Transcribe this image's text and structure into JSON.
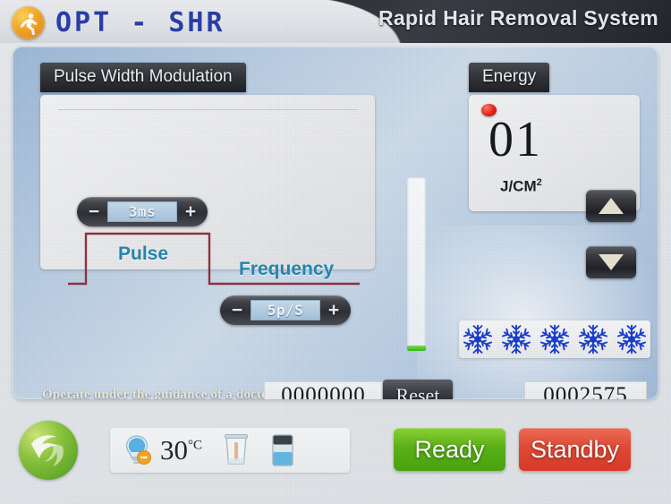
{
  "header": {
    "brand_title": "OPT - SHR",
    "brand_icon": "runner-circle-icon",
    "system_title": "Rapid Hair Removal System"
  },
  "pwm": {
    "title": "Pulse Width Modulation",
    "pulse_width": {
      "minus_label": "−",
      "value": "3ms",
      "plus_label": "+"
    },
    "frequency": {
      "minus_label": "−",
      "value": "5p/S",
      "plus_label": "+"
    },
    "waveform": {
      "pulse_label": "Pulse",
      "frequency_label": "Frequency",
      "trace_color": "#8e3440"
    }
  },
  "energy": {
    "title": "Energy",
    "value": "01",
    "unit": "J/CM",
    "unit_exponent": "2",
    "led_color": "#e8251c",
    "up_arrow": "triangle-up-icon",
    "down_arrow": "triangle-down-icon"
  },
  "gauge": {
    "fill_color": "#3ab51e",
    "fill_percent": 3
  },
  "cooling": {
    "icon": "snowflake-icon",
    "level_count": 5,
    "color": "#1b3ecf"
  },
  "footer_row": {
    "doctor_note": "Operate under the guidance of a doctor",
    "shot_counter": "0000000",
    "reset_label": "Reset",
    "total_counter": "0002575"
  },
  "bottom_bar": {
    "logo_icon": "green-swirl-logo-icon",
    "temperature": "30",
    "temperature_unit": "°C",
    "lamp_icon": "lamp-temperature-icon",
    "water_icon": "water-glass-icon",
    "tank_icon": "coolant-tank-icon",
    "ready_label": "Ready",
    "standby_label": "Standby",
    "ready_color": "#5cb317",
    "standby_color": "#e34b36"
  }
}
